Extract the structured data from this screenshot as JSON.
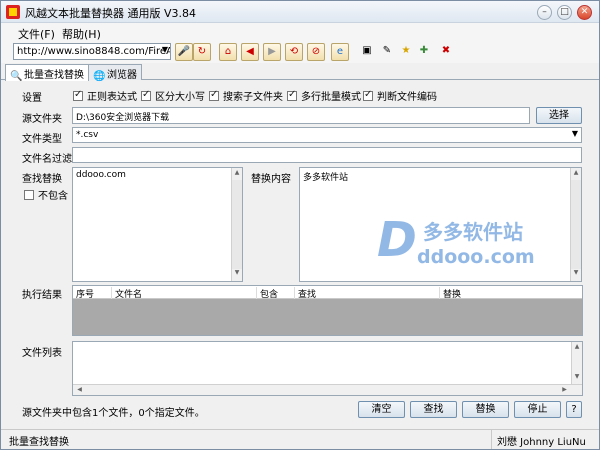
{
  "window": {
    "title": "风越文本批量替换器 通用版 V3.84"
  },
  "menu": {
    "items": [
      "文件(F)",
      "帮助(H)"
    ]
  },
  "toolbar": {
    "url": "http://www.sino8848.com/FireAs"
  },
  "tabs": [
    "批量查找替换",
    "浏览器"
  ],
  "settings": {
    "label": "设置",
    "options": [
      {
        "label": "正则表达式",
        "checked": true
      },
      {
        "label": "区分大小写",
        "checked": true
      },
      {
        "label": "搜索子文件夹",
        "checked": true
      },
      {
        "label": "多行批量模式",
        "checked": true
      },
      {
        "label": "判断文件编码",
        "checked": true
      }
    ]
  },
  "source_folder": {
    "label": "源文件夹",
    "value": "D:\\360安全浏览器下载",
    "button": "选择"
  },
  "file_type": {
    "label": "文件类型",
    "value": "*.csv"
  },
  "filename_filter": {
    "label": "文件名过滤",
    "value": ""
  },
  "find": {
    "label": "查找替换",
    "exclude_label": "不包含",
    "value": "ddooo.com"
  },
  "replace": {
    "label": "替换内容",
    "value": "多多软件站"
  },
  "results": {
    "label": "执行结果",
    "columns": [
      "序号",
      "文件名",
      "包含",
      "查找",
      "替换"
    ]
  },
  "file_list": {
    "label": "文件列表"
  },
  "summary": "源文件夹中包含1个文件，0个指定文件。",
  "actions": {
    "clear": "清空",
    "find": "查找",
    "replace": "替换",
    "stop": "停止",
    "help": "?"
  },
  "status": {
    "left": "批量查找替换",
    "right": "刘懋 Johnny LiuNu"
  },
  "watermark": {
    "brand": "多多软件站",
    "domain": "ddooo.com",
    "letter": "D"
  }
}
